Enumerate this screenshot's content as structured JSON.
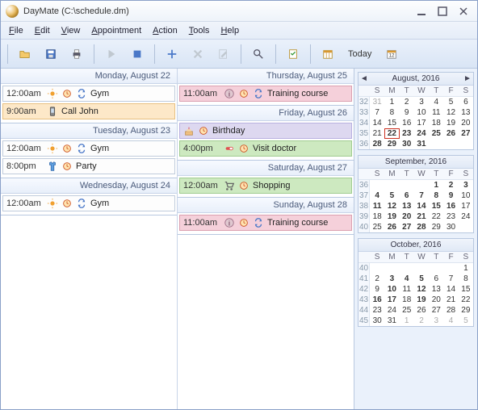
{
  "window": {
    "title": "DayMate (C:\\schedule.dm)"
  },
  "menu": [
    "File",
    "Edit",
    "View",
    "Appointment",
    "Action",
    "Tools",
    "Help"
  ],
  "toolbar": {
    "today": "Today"
  },
  "days": [
    {
      "header": "Monday, August 22",
      "events": [
        {
          "time": "12:00am",
          "title": "Gym",
          "cls": "",
          "icons": [
            "sun",
            "clock",
            "repeat"
          ]
        },
        {
          "time": "9:00am",
          "title": "Call John",
          "cls": "ev-orange",
          "icons": [
            "phone"
          ]
        }
      ]
    },
    {
      "header": "Tuesday, August 23",
      "events": [
        {
          "time": "12:00am",
          "title": "Gym",
          "cls": "",
          "icons": [
            "sun",
            "clock",
            "repeat"
          ]
        },
        {
          "time": "8:00pm",
          "title": "Party",
          "cls": "",
          "icons": [
            "shirt",
            "clock"
          ]
        }
      ]
    },
    {
      "header": "Wednesday, August 24",
      "events": [
        {
          "time": "12:00am",
          "title": "Gym",
          "cls": "",
          "icons": [
            "sun",
            "clock",
            "repeat"
          ]
        }
      ]
    },
    {
      "header": "Thursday, August 25",
      "events": [
        {
          "time": "11:00am",
          "title": "Training course",
          "cls": "ev-pink",
          "icons": [
            "info",
            "clock",
            "repeat"
          ]
        }
      ]
    },
    {
      "header": "Friday, August 26",
      "events": [
        {
          "time": "",
          "title": "Birthday",
          "cls": "ev-purple",
          "icons": [
            "cake",
            "clock"
          ]
        },
        {
          "time": "4:00pm",
          "title": "Visit doctor",
          "cls": "ev-green",
          "icons": [
            "pill",
            "clock"
          ]
        }
      ]
    },
    {
      "header": "Saturday, August 27",
      "events": [
        {
          "time": "12:00am",
          "title": "Shopping",
          "cls": "ev-green",
          "icons": [
            "cart",
            "clock"
          ]
        }
      ]
    },
    {
      "header": "Sunday, August 28",
      "events": [
        {
          "time": "11:00am",
          "title": "Training course",
          "cls": "ev-pink",
          "icons": [
            "info",
            "clock",
            "repeat"
          ]
        }
      ]
    }
  ],
  "calendars": [
    {
      "title": "August, 2016",
      "nav": true,
      "dow": [
        "S",
        "M",
        "T",
        "W",
        "T",
        "F",
        "S"
      ],
      "rows": [
        {
          "wk": "32",
          "days": [
            {
              "n": "31",
              "dim": true
            },
            {
              "n": "1"
            },
            {
              "n": "2"
            },
            {
              "n": "3"
            },
            {
              "n": "4"
            },
            {
              "n": "5"
            },
            {
              "n": "6"
            }
          ]
        },
        {
          "wk": "33",
          "days": [
            {
              "n": "7"
            },
            {
              "n": "8"
            },
            {
              "n": "9"
            },
            {
              "n": "10"
            },
            {
              "n": "11"
            },
            {
              "n": "12"
            },
            {
              "n": "13"
            }
          ]
        },
        {
          "wk": "34",
          "days": [
            {
              "n": "14"
            },
            {
              "n": "15"
            },
            {
              "n": "16"
            },
            {
              "n": "17"
            },
            {
              "n": "18"
            },
            {
              "n": "19"
            },
            {
              "n": "20"
            }
          ]
        },
        {
          "wk": "35",
          "days": [
            {
              "n": "21"
            },
            {
              "n": "22",
              "bold": true,
              "today": true
            },
            {
              "n": "23",
              "bold": true
            },
            {
              "n": "24",
              "bold": true
            },
            {
              "n": "25",
              "bold": true
            },
            {
              "n": "26",
              "bold": true
            },
            {
              "n": "27",
              "bold": true
            }
          ]
        },
        {
          "wk": "36",
          "days": [
            {
              "n": "28",
              "bold": true
            },
            {
              "n": "29",
              "bold": true
            },
            {
              "n": "30",
              "bold": true
            },
            {
              "n": "31",
              "bold": true
            },
            {
              "n": ""
            },
            {
              "n": ""
            },
            {
              "n": ""
            }
          ]
        }
      ]
    },
    {
      "title": "September, 2016",
      "nav": false,
      "dow": [
        "S",
        "M",
        "T",
        "W",
        "T",
        "F",
        "S"
      ],
      "rows": [
        {
          "wk": "36",
          "days": [
            {
              "n": ""
            },
            {
              "n": ""
            },
            {
              "n": ""
            },
            {
              "n": ""
            },
            {
              "n": "1",
              "bold": true
            },
            {
              "n": "2",
              "bold": true
            },
            {
              "n": "3",
              "bold": true
            }
          ]
        },
        {
          "wk": "37",
          "days": [
            {
              "n": "4",
              "bold": true
            },
            {
              "n": "5",
              "bold": true
            },
            {
              "n": "6",
              "bold": true
            },
            {
              "n": "7",
              "bold": true
            },
            {
              "n": "8",
              "bold": true
            },
            {
              "n": "9",
              "bold": true
            },
            {
              "n": "10"
            }
          ]
        },
        {
          "wk": "38",
          "days": [
            {
              "n": "11",
              "bold": true
            },
            {
              "n": "12",
              "bold": true
            },
            {
              "n": "13",
              "bold": true
            },
            {
              "n": "14",
              "bold": true
            },
            {
              "n": "15",
              "bold": true
            },
            {
              "n": "16",
              "bold": true
            },
            {
              "n": "17"
            }
          ]
        },
        {
          "wk": "39",
          "days": [
            {
              "n": "18"
            },
            {
              "n": "19",
              "bold": true
            },
            {
              "n": "20",
              "bold": true
            },
            {
              "n": "21",
              "bold": true
            },
            {
              "n": "22"
            },
            {
              "n": "23"
            },
            {
              "n": "24"
            }
          ]
        },
        {
          "wk": "40",
          "days": [
            {
              "n": "25"
            },
            {
              "n": "26",
              "bold": true
            },
            {
              "n": "27",
              "bold": true
            },
            {
              "n": "28",
              "bold": true
            },
            {
              "n": "29"
            },
            {
              "n": "30"
            },
            {
              "n": ""
            }
          ]
        }
      ]
    },
    {
      "title": "October, 2016",
      "nav": false,
      "dow": [
        "S",
        "M",
        "T",
        "W",
        "T",
        "F",
        "S"
      ],
      "rows": [
        {
          "wk": "40",
          "days": [
            {
              "n": ""
            },
            {
              "n": ""
            },
            {
              "n": ""
            },
            {
              "n": ""
            },
            {
              "n": ""
            },
            {
              "n": ""
            },
            {
              "n": "1"
            }
          ]
        },
        {
          "wk": "41",
          "days": [
            {
              "n": "2"
            },
            {
              "n": "3",
              "bold": true
            },
            {
              "n": "4",
              "bold": true
            },
            {
              "n": "5",
              "bold": true
            },
            {
              "n": "6"
            },
            {
              "n": "7"
            },
            {
              "n": "8"
            }
          ]
        },
        {
          "wk": "42",
          "days": [
            {
              "n": "9"
            },
            {
              "n": "10",
              "bold": true
            },
            {
              "n": "11"
            },
            {
              "n": "12",
              "bold": true
            },
            {
              "n": "13"
            },
            {
              "n": "14"
            },
            {
              "n": "15"
            }
          ]
        },
        {
          "wk": "43",
          "days": [
            {
              "n": "16",
              "bold": true
            },
            {
              "n": "17",
              "bold": true
            },
            {
              "n": "18"
            },
            {
              "n": "19",
              "bold": true
            },
            {
              "n": "20"
            },
            {
              "n": "21"
            },
            {
              "n": "22"
            }
          ]
        },
        {
          "wk": "44",
          "days": [
            {
              "n": "23"
            },
            {
              "n": "24"
            },
            {
              "n": "25"
            },
            {
              "n": "26"
            },
            {
              "n": "27"
            },
            {
              "n": "28"
            },
            {
              "n": "29"
            }
          ]
        },
        {
          "wk": "45",
          "days": [
            {
              "n": "30"
            },
            {
              "n": "31"
            },
            {
              "n": "1",
              "dim": true
            },
            {
              "n": "2",
              "dim": true
            },
            {
              "n": "3",
              "dim": true
            },
            {
              "n": "4",
              "dim": true
            },
            {
              "n": "5",
              "dim": true
            }
          ]
        }
      ]
    }
  ]
}
